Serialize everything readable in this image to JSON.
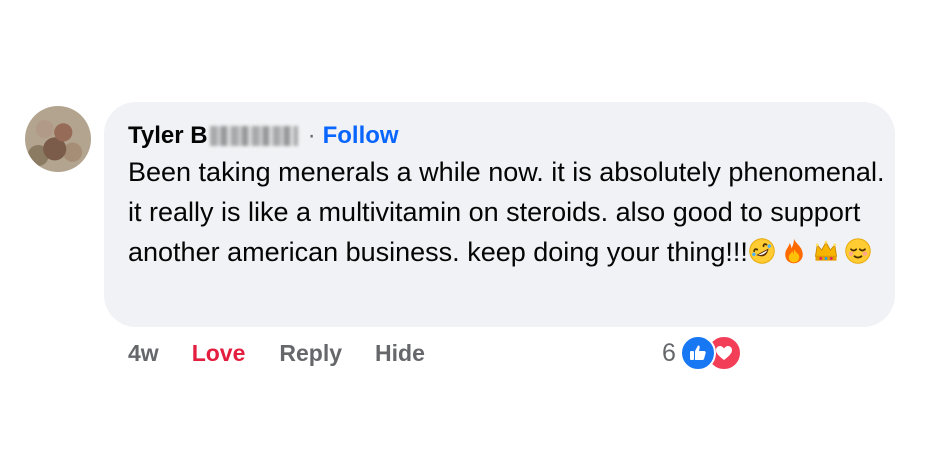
{
  "comment": {
    "author_first": "Tyler B",
    "separator": "·",
    "follow_label": "Follow",
    "text": "Been taking menerals a while now. it is absolutely phenomenal. it really is like a multivitamin on steroids. also good to support another american business. keep doing your thing!!!",
    "emojis": [
      "rolling-on-floor-laughing-emoji",
      "fire-emoji",
      "crown-emoji",
      "relieved-face-emoji"
    ]
  },
  "actions": {
    "timestamp": "4w",
    "love_label": "Love",
    "reply_label": "Reply",
    "hide_label": "Hide"
  },
  "reactions": {
    "count": "6",
    "icons": [
      "like-icon",
      "love-icon"
    ]
  },
  "colors": {
    "bubble": "#f0f2f5",
    "follow": "#0866ff",
    "love": "#e41e3f",
    "secondary_text": "#65676b",
    "like_badge": "#1877f2",
    "love_badge": "#f33e58"
  }
}
